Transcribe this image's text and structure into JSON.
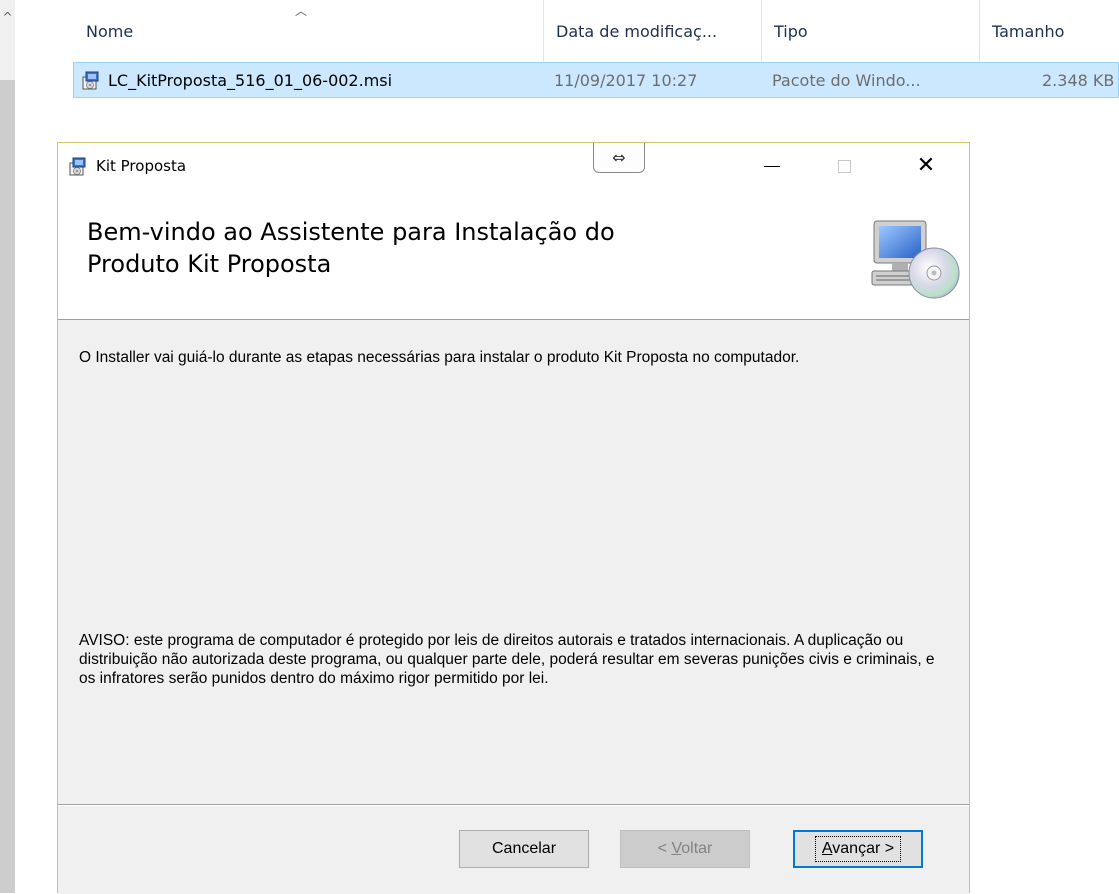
{
  "explorer": {
    "columns": {
      "name": "Nome",
      "date": "Data de modificaç...",
      "type": "Tipo",
      "size": "Tamanho"
    },
    "file": {
      "name": "LC_KitProposta_516_01_06-002.msi",
      "date": "11/09/2017 10:27",
      "type": "Pacote do Windo...",
      "size": "2.348 KB"
    }
  },
  "installer": {
    "title": "Kit Proposta",
    "resize_glyph": "⇔",
    "heading_line1": "Bem-vindo ao Assistente para Instalação do",
    "heading_line2": "Produto Kit Proposta",
    "intro": "O Installer vai guiá-lo durante as etapas necessárias para instalar o produto Kit Proposta no computador.",
    "warning": "AVISO: este programa de computador é protegido por leis de direitos autorais e tratados internacionais. A duplicação ou distribuição não autorizada deste programa, ou qualquer parte dele, poderá resultar em severas punições civis e criminais, e os infratores serão punidos dentro do máximo rigor permitido por lei.",
    "buttons": {
      "cancel": "Cancelar",
      "back_prefix": "< ",
      "back_key": "V",
      "back_rest": "oltar",
      "next_key": "A",
      "next_rest": "vançar >"
    }
  },
  "colors": {
    "selection": "#cce8ff",
    "selection_border": "#99d1ff",
    "window_border": "#c9c96a",
    "dialog_bg": "#f0f0f0",
    "default_button_border": "#0078d7"
  }
}
